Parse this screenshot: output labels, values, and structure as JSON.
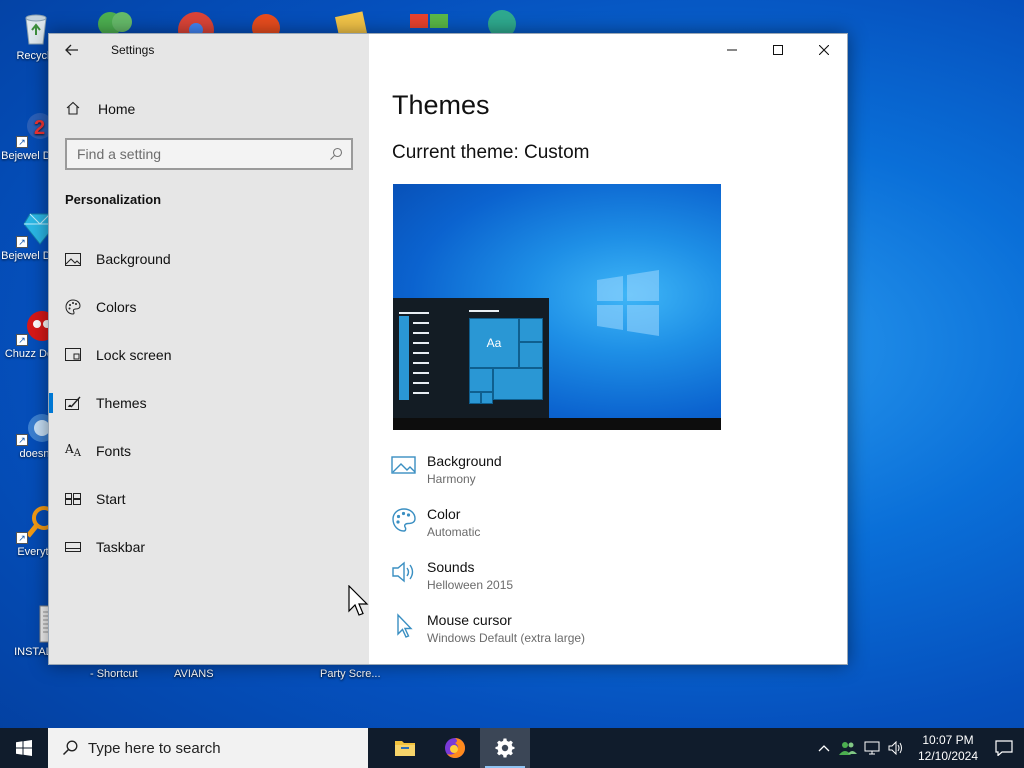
{
  "desktop": {
    "icons": [
      {
        "label": "Recycle",
        "icon": "recycle-bin-icon"
      },
      {
        "label": "Bejewel Delux",
        "icon": "bejeweled-icon"
      },
      {
        "label": "Bejewel Delux",
        "icon": "bejeweled-icon"
      },
      {
        "label": "Chuzz Delux",
        "icon": "chuzzle-icon"
      },
      {
        "label": "doesnt",
        "icon": "app-icon"
      },
      {
        "label": "Everyth",
        "icon": "everything-search-icon"
      },
      {
        "label": "INSTALL",
        "icon": "document-icon"
      }
    ],
    "partial_labels": {
      "shortcut": "- Shortcut",
      "avians": "AVIANS",
      "party": "Party Scre..."
    }
  },
  "window": {
    "title": "Settings",
    "home_label": "Home",
    "search": {
      "placeholder": "Find a setting",
      "value": ""
    },
    "section": "Personalization",
    "nav_items": [
      {
        "label": "Background",
        "icon": "picture-icon"
      },
      {
        "label": "Colors",
        "icon": "palette-icon"
      },
      {
        "label": "Lock screen",
        "icon": "lock-screen-icon"
      },
      {
        "label": "Themes",
        "icon": "themes-icon",
        "selected": true
      },
      {
        "label": "Fonts",
        "icon": "fonts-icon"
      },
      {
        "label": "Start",
        "icon": "start-icon"
      },
      {
        "label": "Taskbar",
        "icon": "taskbar-icon"
      }
    ]
  },
  "content": {
    "page_title": "Themes",
    "current_theme": "Current theme: Custom",
    "preview_tile": "Aa",
    "properties": [
      {
        "name": "Background",
        "value": "Harmony",
        "icon": "picture-icon"
      },
      {
        "name": "Color",
        "value": "Automatic",
        "icon": "palette-icon"
      },
      {
        "name": "Sounds",
        "value": "Helloween 2015",
        "icon": "speaker-icon"
      },
      {
        "name": "Mouse cursor",
        "value": "Windows Default (extra large)",
        "icon": "cursor-icon"
      }
    ]
  },
  "taskbar": {
    "search_placeholder": "Type here to search",
    "apps": [
      {
        "name": "File Explorer",
        "icon": "folder-icon"
      },
      {
        "name": "Firefox",
        "icon": "firefox-icon"
      },
      {
        "name": "Settings",
        "icon": "gear-icon",
        "active": true
      }
    ],
    "clock_time": "10:07 PM",
    "clock_date": "12/10/2024"
  },
  "colors": {
    "accent": "#0078d4",
    "icon_blue": "#3a8fc2",
    "sidebar_bg": "#e6e6e6",
    "taskbar_bg": "#101c2c"
  }
}
